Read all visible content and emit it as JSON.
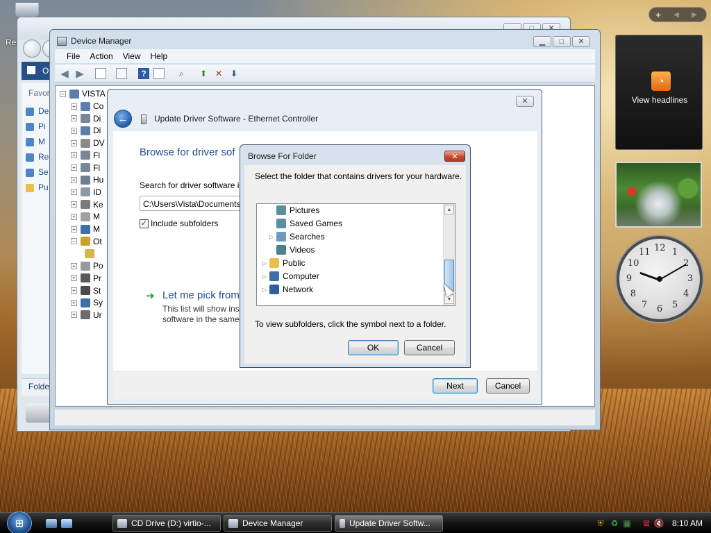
{
  "desktop": {
    "recycle_label": "Re"
  },
  "background_window": {
    "address_text": "O",
    "favorites_label": "Favor",
    "fav_items": [
      "De",
      "Pi",
      "M",
      "Re",
      "Se",
      "Pu"
    ],
    "folders_label": "Folde"
  },
  "device_manager": {
    "title": "Device Manager",
    "menu": [
      "File",
      "Action",
      "View",
      "Help"
    ],
    "tree_root": "VISTA",
    "tree_items": [
      "Co",
      "Di",
      "Di",
      "DV",
      "Fl",
      "Fl",
      "Hu",
      "ID",
      "Ke",
      "M",
      "M",
      "Ot",
      "",
      "Po",
      "Pr",
      "St",
      "Sy",
      "Ur"
    ]
  },
  "update_driver": {
    "title": "Update Driver Software - Ethernet Controller",
    "heading": "Browse for driver sof",
    "search_label": "Search for driver software in",
    "path_value": "C:\\Users\\Vista\\Documents",
    "include_subfolders": "Include subfolders",
    "pick_title": "Let me pick from",
    "pick_desc_1": "This list will show inst",
    "pick_desc_2": "software in the same",
    "next_label": "Next",
    "cancel_label": "Cancel"
  },
  "browse_folder": {
    "title": "Browse For Folder",
    "instruction": "Select the folder that contains drivers for your hardware.",
    "items": [
      {
        "label": "Pictures",
        "expandable": false,
        "icon": "pictures-folder-icon",
        "color": "#5a8fa0"
      },
      {
        "label": "Saved Games",
        "expandable": false,
        "icon": "saved-games-folder-icon",
        "color": "#5a8fa0"
      },
      {
        "label": "Searches",
        "expandable": true,
        "icon": "searches-folder-icon",
        "color": "#6d9bbd"
      },
      {
        "label": "Videos",
        "expandable": false,
        "icon": "videos-folder-icon",
        "color": "#4f7f8f"
      },
      {
        "label": "Public",
        "expandable": true,
        "icon": "public-folder-icon",
        "color": "#e8c04a"
      },
      {
        "label": "Computer",
        "expandable": true,
        "icon": "computer-icon",
        "color": "#3f6ea8"
      },
      {
        "label": "Network",
        "expandable": true,
        "icon": "network-icon",
        "color": "#2f5e9e"
      }
    ],
    "hint": "To view subfolders, click the symbol next to a folder.",
    "ok_label": "OK",
    "cancel_label": "Cancel"
  },
  "sidebar": {
    "feeds_label": "View headlines",
    "clock_numbers": [
      "12",
      "1",
      "2",
      "3",
      "4",
      "5",
      "6",
      "7",
      "8",
      "9",
      "10",
      "11"
    ]
  },
  "taskbar": {
    "tasks": [
      {
        "label": "CD Drive (D:) virtio-..."
      },
      {
        "label": "Device Manager"
      },
      {
        "label": "Update Driver Softw..."
      }
    ],
    "time": "8:10 AM"
  },
  "colors": {
    "accent_blue": "#1f4e8c",
    "close_red": "#c4452e",
    "taskbar": "#141414"
  }
}
